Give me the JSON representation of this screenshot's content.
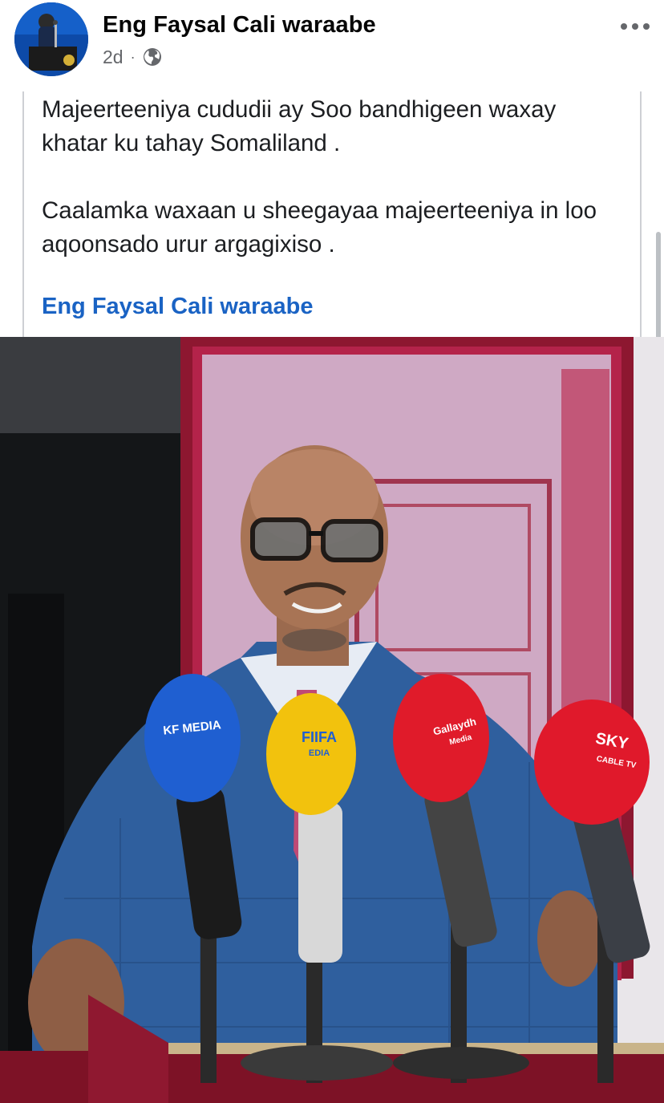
{
  "post": {
    "author_name": "Eng Faysal Cali waraabe",
    "timestamp": "2d",
    "separator": "·",
    "privacy_icon": "globe-icon",
    "more_icon": "more-horizontal-icon",
    "paragraphs": [
      "Majeerteeniya cududii ay Soo bandhigeen waxay khatar ku tahay Somaliland .",
      "Caalamka waxaan u sheegayaa majeerteeniya in loo aqoonsado urur argagixiso ."
    ],
    "signature_link": "Eng Faysal Cali waraabe"
  },
  "photo": {
    "microphones": [
      {
        "label": "KF MEDIA",
        "color": "#1f5fd1"
      },
      {
        "label": "FIIFA",
        "sublabel": "EDIA",
        "color": "#f2c20d"
      },
      {
        "label": "Gallaydh",
        "sublabel": "Media",
        "color": "#e01b2a"
      },
      {
        "label": "SKY",
        "sublabel": "CABLE TV",
        "color": "#e0192b"
      }
    ]
  },
  "colors": {
    "link": "#1a63c4",
    "meta_text": "#65676b",
    "body_text": "#1c1e21"
  }
}
